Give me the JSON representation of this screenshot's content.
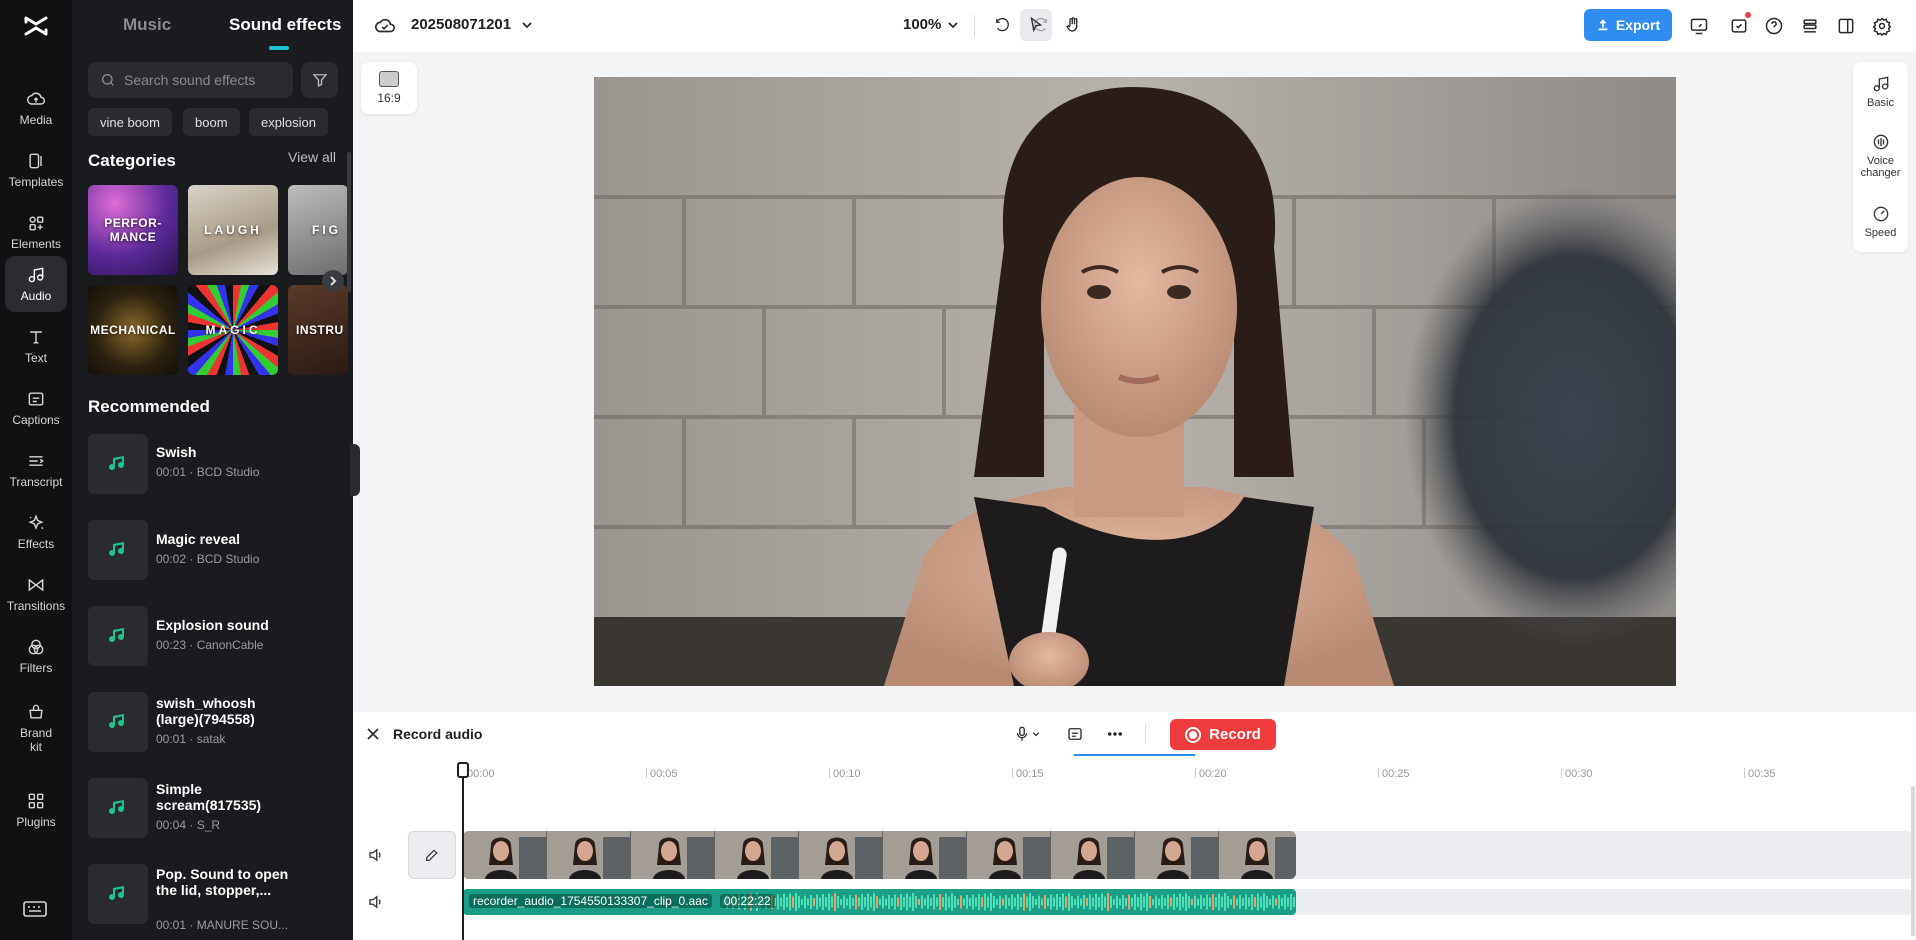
{
  "app": {
    "logo": "capcut-logo-icon"
  },
  "rail": {
    "items": [
      {
        "label": "Media",
        "icon": "cloud-upload-icon"
      },
      {
        "label": "Templates",
        "icon": "templates-icon"
      },
      {
        "label": "Elements",
        "icon": "elements-icon"
      },
      {
        "label": "Audio",
        "icon": "music-note-icon",
        "active": true
      },
      {
        "label": "Text",
        "icon": "text-t-icon"
      },
      {
        "label": "Captions",
        "icon": "captions-icon"
      },
      {
        "label": "Transcript",
        "icon": "transcript-icon"
      },
      {
        "label": "Effects",
        "icon": "sparkle-icon"
      },
      {
        "label": "Transitions",
        "icon": "transitions-icon"
      },
      {
        "label": "Filters",
        "icon": "filters-icon"
      },
      {
        "label": "Brand kit",
        "icon": "brand-kit-icon"
      },
      {
        "label": "Plugins",
        "icon": "plugins-grid-icon"
      }
    ]
  },
  "panel": {
    "tabs": [
      {
        "label": "Music"
      },
      {
        "label": "Sound effects",
        "active": true
      }
    ],
    "search": {
      "placeholder": "Search sound effects"
    },
    "chips": [
      "vine boom",
      "boom",
      "explosion"
    ],
    "categories_title": "Categories",
    "view_all": "View all",
    "categories": [
      {
        "label": "PERFOR-\nMANCE"
      },
      {
        "label": "LAUGH"
      },
      {
        "label": "FIG"
      },
      {
        "label": "MECHANICAL"
      },
      {
        "label": "MAGIC"
      },
      {
        "label": "INSTRU"
      }
    ],
    "recommended_title": "Recommended",
    "recommended": [
      {
        "name": "Swish",
        "meta": "00:01 · BCD Studio"
      },
      {
        "name": "Magic reveal",
        "meta": "00:02 · BCD Studio"
      },
      {
        "name": "Explosion sound",
        "meta": "00:23 · CanonCable"
      },
      {
        "name": "swish_whoosh (large)(794558)",
        "meta": "00:01 · satak"
      },
      {
        "name": "Simple scream(817535)",
        "meta": "00:04 · S_R"
      },
      {
        "name": "Pop. Sound to open the lid, stopper,...",
        "meta": "00:01 · MANURE SOU..."
      }
    ]
  },
  "topbar": {
    "project_name": "202508071201",
    "zoom": "100%",
    "export_label": "Export"
  },
  "canvas": {
    "ratio_label": "16:9"
  },
  "right_tools": [
    {
      "label": "Basic",
      "icon": "music-note-icon"
    },
    {
      "label": "Voice changer",
      "icon": "voice-changer-icon"
    },
    {
      "label": "Speed",
      "icon": "speed-gauge-icon"
    }
  ],
  "record": {
    "title": "Record audio",
    "button_label": "Record"
  },
  "timeline": {
    "ticks": [
      "00:00",
      "00:05",
      "00:10",
      "00:15",
      "00:20",
      "00:25",
      "00:30",
      "00:35"
    ],
    "audio_clip_name": "recorder_audio_1754550133307_clip_0.aac",
    "audio_clip_duration": "00:22:22"
  },
  "colors": {
    "accent": "#1fc3d6",
    "export": "#2f8cf0",
    "record": "#ef3b3b",
    "audio_clip": "#1a9f86",
    "music_icon": "#1ec28b"
  }
}
